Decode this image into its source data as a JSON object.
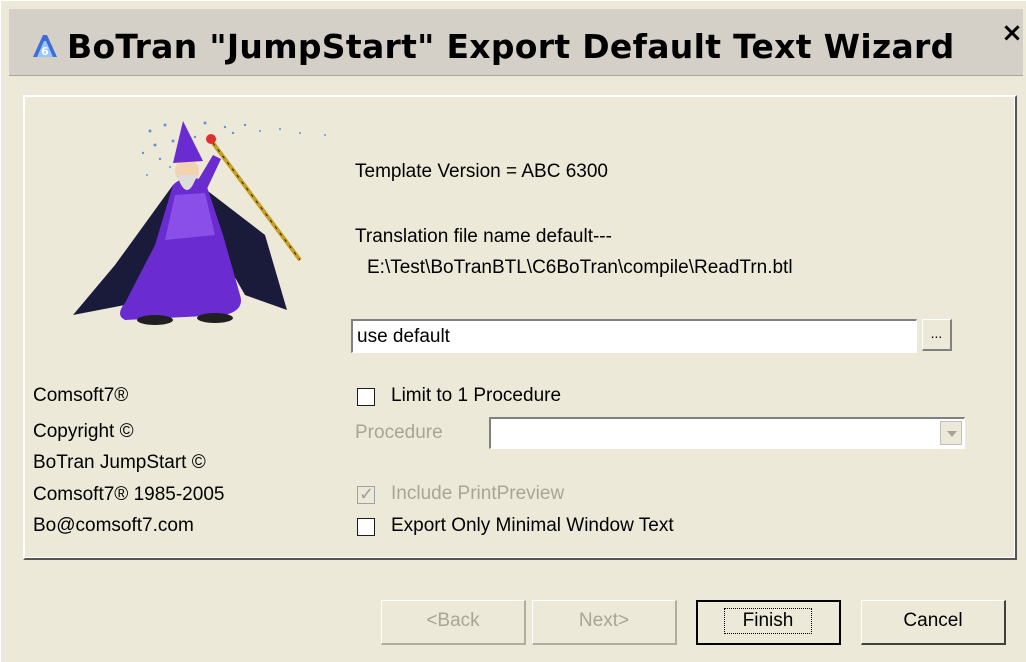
{
  "window": {
    "title": "BoTran \"JumpStart\" Export Default Text Wizard",
    "app_icon": "botran-a6-icon",
    "close_label": "×"
  },
  "info": {
    "lines": [
      "Comsoft7®",
      "Copyright ©",
      "BoTran JumpStart ©",
      "Comsoft7® 1985-2005",
      "Bo@comsoft7.com"
    ]
  },
  "details": {
    "template_version": "Template Version = ABC 6300",
    "translation_label": "Translation file name default---",
    "translation_path": "E:\\Test\\BoTranBTL\\C6BoTran\\compile\\ReadTrn.btl"
  },
  "file_input": {
    "value": "use default",
    "browse_label": "..."
  },
  "options": {
    "limit_label": "Limit to 1 Procedure",
    "limit_checked": false,
    "procedure_label": "Procedure",
    "procedure_value": "",
    "print_preview_label": "Include PrintPreview",
    "print_preview_checked": true,
    "print_preview_enabled": false,
    "minimal_label": "Export Only Minimal Window Text",
    "minimal_checked": false
  },
  "buttons": {
    "back": "<Back",
    "next": "Next>",
    "finish": "Finish",
    "cancel": "Cancel"
  },
  "colors": {
    "face": "#ece9d8",
    "disabled_text": "#a8a596",
    "wizard_robe": "#6a2bd0"
  }
}
